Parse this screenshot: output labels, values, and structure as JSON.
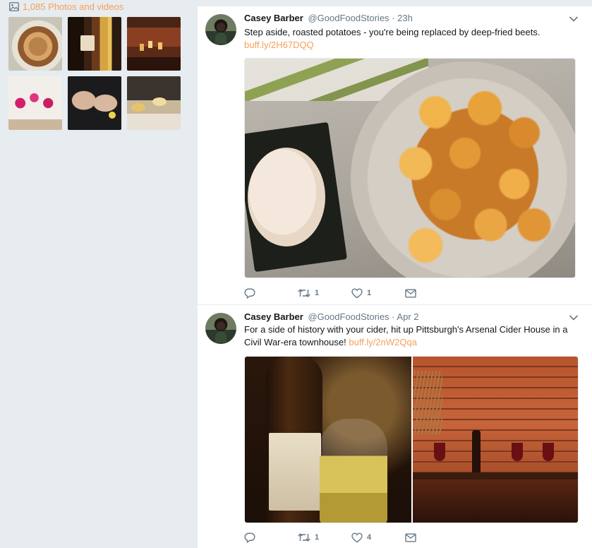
{
  "sidebar": {
    "media_link_label": "1,085 Photos and videos"
  },
  "tweets": [
    {
      "name": "Casey Barber",
      "handle": "@GoodFoodStories",
      "separator": "·",
      "time": "23h",
      "text": "Step aside, roasted potatoes - you're being replaced by deep-fried beets.",
      "link": "buff.ly/2H67DQQ",
      "replies": "",
      "retweets": "1",
      "likes": "1"
    },
    {
      "name": "Casey Barber",
      "handle": "@GoodFoodStories",
      "separator": "·",
      "time": "Apr 2",
      "text": "For a side of history with your cider, hit up Pittsburgh's Arsenal Cider House in a Civil War-era townhouse!",
      "link": "buff.ly/2nW2Qqa",
      "replies": "",
      "retweets": "1",
      "likes": "4"
    }
  ],
  "colors": {
    "link": "#f5a05a",
    "secondary_text": "#657786",
    "background": "#e6ecf0"
  }
}
